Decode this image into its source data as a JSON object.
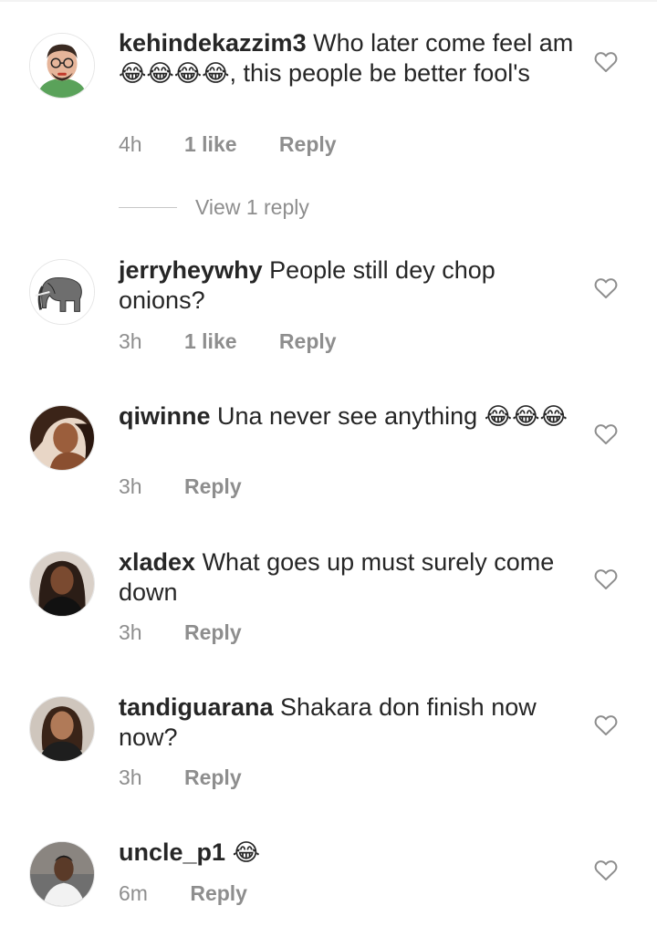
{
  "colors": {
    "text": "#262626",
    "muted": "#8e8e8e",
    "divider": "#c7c7c7"
  },
  "comments": [
    {
      "username": "kehindekazzim3",
      "text": "Who later come feel am",
      "emoji": "😂😂😂😂",
      "text_after": ", this people be better fool's",
      "time": "4h",
      "likes": "1 like",
      "reply": "Reply",
      "view_replies": "View 1 reply",
      "avatar_icon": "cartoon-avatar-glasses"
    },
    {
      "username": "jerryheywhy",
      "text": "People still dey chop onions?",
      "time": "3h",
      "likes": "1 like",
      "reply": "Reply",
      "avatar_icon": "elephant-sketch-avatar"
    },
    {
      "username": "qiwinne",
      "text": "Una never see anything",
      "emoji": "😂😂😂",
      "time": "3h",
      "reply": "Reply",
      "avatar_icon": "woman-photo-avatar"
    },
    {
      "username": "xladex",
      "text": "What goes up must surely come down",
      "time": "3h",
      "reply": "Reply",
      "avatar_icon": "woman-photo-avatar"
    },
    {
      "username": "tandiguarana",
      "text": "Shakara don finish now now?",
      "time": "3h",
      "reply": "Reply",
      "avatar_icon": "woman-photo-avatar"
    },
    {
      "username": "uncle_p1",
      "text": "",
      "emoji": "😂",
      "time": "6m",
      "reply": "Reply",
      "avatar_icon": "man-photo-avatar"
    }
  ]
}
